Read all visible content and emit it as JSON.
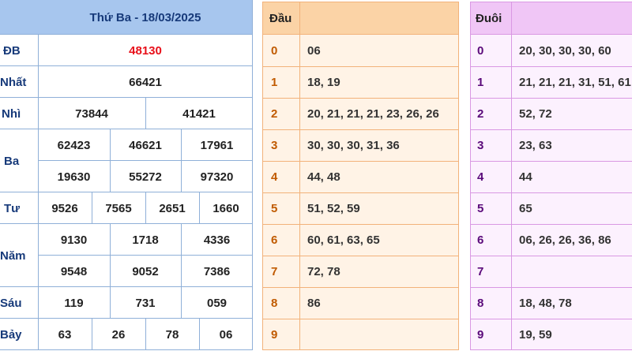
{
  "results": {
    "header": "Thứ Ba - 18/03/2025",
    "colors": {
      "header_bg": "#a7c6ee",
      "label": "#173a7a",
      "special": "#e8101a",
      "border": "#8fb0d8"
    },
    "prizes": [
      {
        "label": "ĐB",
        "values": [
          "48130"
        ]
      },
      {
        "label": "Nhất",
        "values": [
          "66421"
        ]
      },
      {
        "label": "Nhì",
        "values": [
          "73844",
          "41421"
        ]
      },
      {
        "label": "Ba",
        "values": [
          "62423",
          "46621",
          "17961",
          "19630",
          "55272",
          "97320"
        ]
      },
      {
        "label": "Tư",
        "values": [
          "9526",
          "7565",
          "2651",
          "1660"
        ]
      },
      {
        "label": "Năm",
        "values": [
          "9130",
          "1718",
          "4336",
          "9548",
          "9052",
          "7386"
        ]
      },
      {
        "label": "Sáu",
        "values": [
          "119",
          "731",
          "059"
        ]
      },
      {
        "label": "Bảy",
        "values": [
          "63",
          "26",
          "78",
          "06"
        ]
      }
    ]
  },
  "dau": {
    "header": "Đầu",
    "colors": {
      "header_bg": "#fbd3a6",
      "body_bg": "#fff3e6",
      "border": "#f2b27a",
      "digit": "#c05a00"
    },
    "rows": [
      {
        "digit": "0",
        "values": "06"
      },
      {
        "digit": "1",
        "values": "18, 19"
      },
      {
        "digit": "2",
        "values": "20, 21, 21, 21, 23, 26, 26"
      },
      {
        "digit": "3",
        "values": "30, 30, 30, 31, 36"
      },
      {
        "digit": "4",
        "values": "44, 48"
      },
      {
        "digit": "5",
        "values": "51, 52, 59"
      },
      {
        "digit": "6",
        "values": "60, 61, 63, 65"
      },
      {
        "digit": "7",
        "values": "72, 78"
      },
      {
        "digit": "8",
        "values": "86"
      },
      {
        "digit": "9",
        "values": ""
      }
    ]
  },
  "duoi": {
    "header": "Đuôi",
    "colors": {
      "header_bg": "#f0c6f6",
      "body_bg": "#fcf1fe",
      "border": "#d998e3",
      "digit": "#5a0a7a"
    },
    "rows": [
      {
        "digit": "0",
        "values": "20, 30, 30, 30, 60"
      },
      {
        "digit": "1",
        "values": "21, 21, 21, 31, 51, 61"
      },
      {
        "digit": "2",
        "values": "52, 72"
      },
      {
        "digit": "3",
        "values": "23, 63"
      },
      {
        "digit": "4",
        "values": "44"
      },
      {
        "digit": "5",
        "values": "65"
      },
      {
        "digit": "6",
        "values": "06, 26, 26, 36, 86"
      },
      {
        "digit": "7",
        "values": ""
      },
      {
        "digit": "8",
        "values": "18, 48, 78"
      },
      {
        "digit": "9",
        "values": "19, 59"
      }
    ]
  }
}
